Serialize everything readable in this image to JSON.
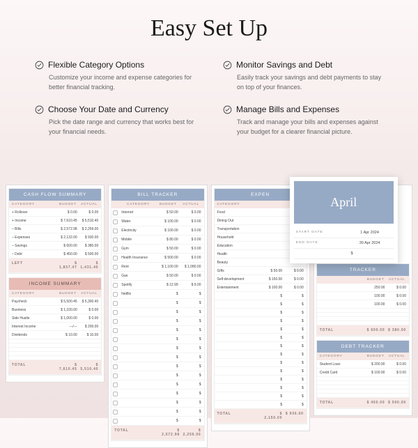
{
  "title": "Easy Set Up",
  "features": [
    {
      "title": "Flexible Category Options",
      "desc": "Customize your income and expense categories for better financial tracking."
    },
    {
      "title": "Monitor Savings and Debt",
      "desc": "Easily track your savings and debt payments to stay on top of your finances."
    },
    {
      "title": "Choose Your Date and Currency",
      "desc": "Pick the date range and currency that works best for your financial needs."
    },
    {
      "title": "Manage Bills and Expenses",
      "desc": "Track and manage your bills and expenses against your budget for a clearer financial picture."
    }
  ],
  "cashflow": {
    "title": "CASH FLOW SUMMARY",
    "cols": [
      "CATEGORY",
      "BUDGET",
      "ACTUAL"
    ],
    "rows": [
      {
        "c": "+  Rollover",
        "b": "$       0.00",
        "a": "$       0.00"
      },
      {
        "c": "+  Income",
        "b": "$   7,610.45",
        "a": "$   5,510.40"
      },
      {
        "c": "–  Bills",
        "b": "$   2,572.98",
        "a": "$   2,259.00"
      },
      {
        "c": "–  Expenses",
        "b": "$   2,132.00",
        "a": "$    930.00"
      },
      {
        "c": "–  Savings",
        "b": "$    600.00",
        "a": "$    380.00"
      },
      {
        "c": "–  Debt",
        "b": "$    450.00",
        "a": "$    500.00"
      }
    ],
    "left": {
      "c": "LEFT",
      "b": "$   1,837.47",
      "a": "$   1,431.40"
    }
  },
  "income": {
    "title": "INCOME SUMMARY",
    "cols": [
      "CATEGORY",
      "BUDGET",
      "ACTUAL"
    ],
    "rows": [
      {
        "c": "Paycheck",
        "b": "$   5,500.45",
        "a": "$   5,300.40"
      },
      {
        "c": "Business",
        "b": "$   1,100.00",
        "a": "$     0.00"
      },
      {
        "c": "Side Hustle",
        "b": "$   1,000.00",
        "a": "$     0.00"
      },
      {
        "c": "Interest Income",
        "b": "---/---",
        "a": "$   200.00"
      },
      {
        "c": "Dividends",
        "b": "$      10.00",
        "a": "$    10.00"
      },
      {
        "c": " ",
        "b": " ",
        "a": " "
      },
      {
        "c": " ",
        "b": " ",
        "a": " "
      },
      {
        "c": " ",
        "b": " ",
        "a": " "
      },
      {
        "c": " ",
        "b": " ",
        "a": " "
      },
      {
        "c": " ",
        "b": " ",
        "a": " "
      }
    ],
    "total": {
      "c": "TOTAL",
      "b": "$   7,610.45",
      "a": "$   5,510.40"
    }
  },
  "bills": {
    "title": "BILL TRACKER",
    "cols": [
      "",
      "CATEGORY",
      "BUDGET",
      "ACTUAL"
    ],
    "rows": [
      {
        "c": "Internet",
        "b": "$     50.00",
        "a": "$     0.00"
      },
      {
        "c": "Water",
        "b": "$    100.00",
        "a": "$     0.00"
      },
      {
        "c": "Electricity",
        "b": "$    100.00",
        "a": "$     0.00"
      },
      {
        "c": "Mobile",
        "b": "$     80.00",
        "a": "$     0.00"
      },
      {
        "c": "Gym",
        "b": "$     50.00",
        "a": "$     0.00"
      },
      {
        "c": "Health Insurance",
        "b": "$    500.00",
        "a": "$     0.00"
      },
      {
        "c": "Rent",
        "b": "$  1,100.00",
        "a": "$ 1,080.00"
      },
      {
        "c": "Gas",
        "b": "$     50.00",
        "a": "$     0.00"
      },
      {
        "c": "Spotify",
        "b": "$     12.99",
        "a": "$     9.00"
      },
      {
        "c": "Netflix",
        "b": "$      ",
        "a": "$      "
      },
      {
        "c": " ",
        "b": "$      ",
        "a": "$      "
      },
      {
        "c": " ",
        "b": "$      ",
        "a": "$      "
      },
      {
        "c": " ",
        "b": "$      ",
        "a": "$      "
      },
      {
        "c": " ",
        "b": "$      ",
        "a": "$      "
      },
      {
        "c": " ",
        "b": "$      ",
        "a": "$      "
      },
      {
        "c": " ",
        "b": "$      ",
        "a": "$      "
      },
      {
        "c": " ",
        "b": "$      ",
        "a": "$      "
      },
      {
        "c": " ",
        "b": "$      ",
        "a": "$      "
      },
      {
        "c": " ",
        "b": "$      ",
        "a": "$      "
      },
      {
        "c": " ",
        "b": "$      ",
        "a": "$      "
      },
      {
        "c": " ",
        "b": "$      ",
        "a": "$      "
      },
      {
        "c": " ",
        "b": "$      ",
        "a": "$      "
      },
      {
        "c": " ",
        "b": "$      ",
        "a": "$      "
      },
      {
        "c": " ",
        "b": "$      ",
        "a": "$      "
      }
    ],
    "total": {
      "c": "TOTAL",
      "b": "$   2,572.98",
      "a": "$   2,259.00"
    }
  },
  "expenses": {
    "title": "EXPEN",
    "cols": [
      "CATEGORY",
      "",
      ""
    ],
    "rows": [
      {
        "c": "Food"
      },
      {
        "c": "Dining Out"
      },
      {
        "c": "Transportation"
      },
      {
        "c": "Household"
      },
      {
        "c": "Education"
      },
      {
        "c": "Health"
      },
      {
        "c": "Beauty"
      },
      {
        "c": "Gifts",
        "b": "$    50.00",
        "a": "$     0.00"
      },
      {
        "c": "Self-development",
        "b": "$   150.00",
        "a": "$     0.00"
      },
      {
        "c": "Entertainment",
        "b": "$   100.00",
        "a": "$     0.00"
      },
      {
        "c": " ",
        "b": "$      ",
        "a": "$      "
      },
      {
        "c": " ",
        "b": "$      ",
        "a": "$      "
      },
      {
        "c": " ",
        "b": "$      ",
        "a": "$      "
      },
      {
        "c": " ",
        "b": "$      ",
        "a": "$      "
      },
      {
        "c": " ",
        "b": "$      ",
        "a": "$      "
      },
      {
        "c": " ",
        "b": "$      ",
        "a": "$      "
      },
      {
        "c": " ",
        "b": "$      ",
        "a": "$      "
      },
      {
        "c": " ",
        "b": "$      ",
        "a": "$      "
      },
      {
        "c": " ",
        "b": "$      ",
        "a": "$      "
      },
      {
        "c": " ",
        "b": "$      ",
        "a": "$      "
      },
      {
        "c": " ",
        "b": "$      ",
        "a": "$      "
      },
      {
        "c": " ",
        "b": "$      ",
        "a": "$      "
      },
      {
        "c": " ",
        "b": "$      ",
        "a": "$      "
      },
      {
        "c": " ",
        "b": "$      ",
        "a": "$      "
      }
    ],
    "total": {
      "c": "TOTAL",
      "b": "$   2,150.00",
      "a": "$   930.00"
    }
  },
  "savings": {
    "title": "TRACKER",
    "cols": [
      "",
      "BUDGET",
      "ACTUAL"
    ],
    "rows": [
      {
        "c": "",
        "b": "250.00",
        "a": "$     0.00"
      },
      {
        "c": "",
        "b": "100.00",
        "a": "$     0.00"
      },
      {
        "c": "",
        "b": "100.00",
        "a": "$     0.00"
      },
      {
        "c": " ",
        "b": " ",
        "a": " "
      },
      {
        "c": " ",
        "b": " ",
        "a": " "
      },
      {
        "c": " ",
        "b": " ",
        "a": " "
      },
      {
        "c": " ",
        "b": " ",
        "a": " "
      }
    ],
    "total": {
      "c": "TOTAL",
      "b": "$   600.00",
      "a": "$   380.00"
    }
  },
  "debt": {
    "title": "DEBT TRACKER",
    "cols": [
      "CATEGORY",
      "BUDGET",
      "ACTUAL"
    ],
    "rows": [
      {
        "c": "Student Loan",
        "b": "$   200.00",
        "a": "$     0.00"
      },
      {
        "c": "Credit Card",
        "b": "$   100.00",
        "a": "$     0.00"
      },
      {
        "c": " ",
        "b": " ",
        "a": " "
      },
      {
        "c": " ",
        "b": " ",
        "a": " "
      },
      {
        "c": " ",
        "b": " ",
        "a": " "
      },
      {
        "c": " ",
        "b": " ",
        "a": " "
      },
      {
        "c": " ",
        "b": " ",
        "a": " "
      }
    ],
    "total": {
      "c": "TOTAL",
      "b": "$   450.00",
      "a": "$   500.00"
    }
  },
  "popup": {
    "month": "April",
    "start_label": "START DATE",
    "start_value": "1 Apr 2024",
    "end_label": "END DATE",
    "end_value": "30 Apr 2024",
    "currency": "$"
  }
}
